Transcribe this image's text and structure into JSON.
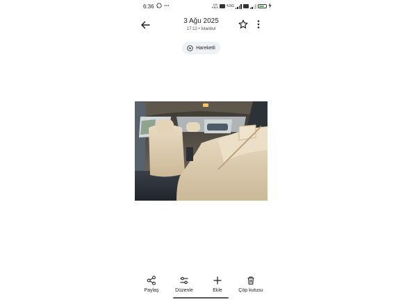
{
  "status_bar": {
    "time": "6:36",
    "net_speed_value": "105",
    "net_speed_unit": "KB/S",
    "network_label": "4.5G",
    "battery_level": 0.8
  },
  "header": {
    "title": "3 Ağu 2025",
    "subtitle": "17:12 • İstanbul"
  },
  "motion_chip": {
    "label": "Hareketli"
  },
  "actions": [
    {
      "label": "Paylaş",
      "icon": "share-icon"
    },
    {
      "label": "Düzenle",
      "icon": "tune-icon"
    },
    {
      "label": "Ekle",
      "icon": "plus-icon"
    },
    {
      "label": "Çöp kutusu",
      "icon": "trash-icon"
    }
  ],
  "colors": {
    "chip_background": "#eef1f5",
    "text": "#1f1f1f",
    "battery": "#4caf50"
  }
}
